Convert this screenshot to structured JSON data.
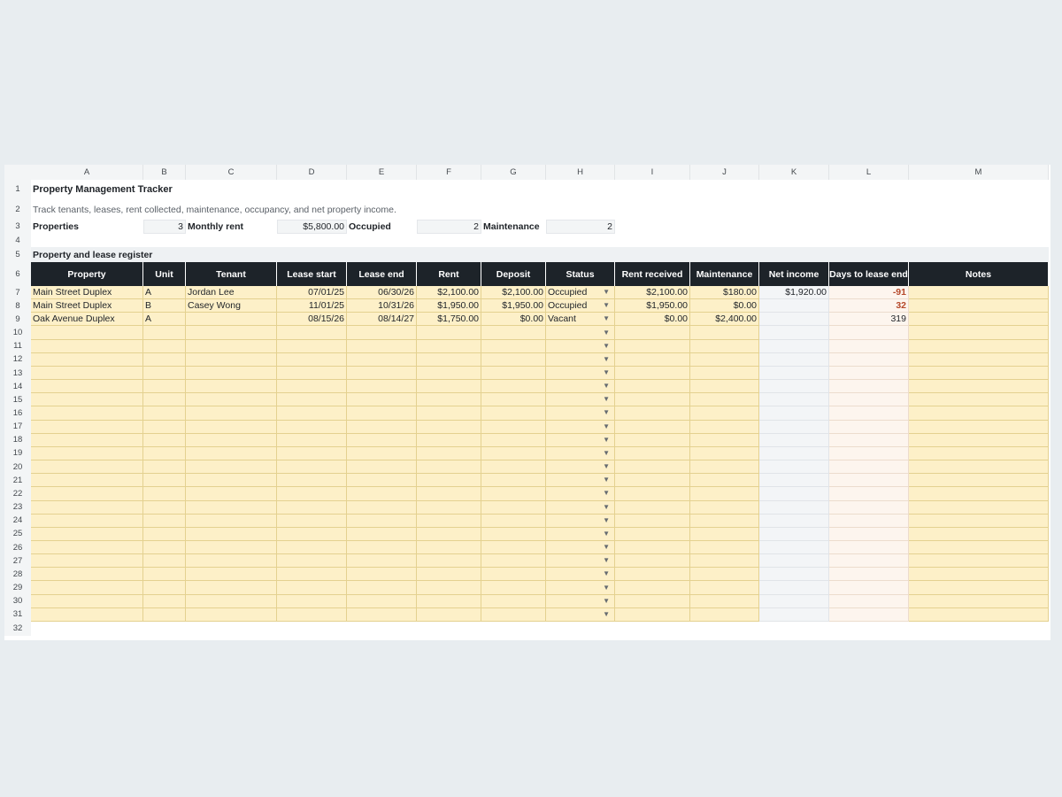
{
  "columns": [
    "A",
    "B",
    "C",
    "D",
    "E",
    "F",
    "G",
    "H",
    "I",
    "J",
    "K",
    "L",
    "M"
  ],
  "title": "Property Management Tracker",
  "subtitle": "Track tenants, leases, rent collected, maintenance, occupancy, and net property income.",
  "summary": [
    {
      "label": "Properties",
      "value": "3"
    },
    {
      "label": "Monthly rent",
      "value": "$5,800.00"
    },
    {
      "label": "Occupied",
      "value": "2"
    },
    {
      "label": "Maintenance",
      "value": "2"
    }
  ],
  "section_title": "Property and lease register",
  "table": {
    "headers": [
      "Property",
      "Unit",
      "Tenant",
      "Lease start",
      "Lease end",
      "Rent",
      "Deposit",
      "Status",
      "Rent received",
      "Maintenance",
      "Net income",
      "Days to lease end",
      "Notes"
    ],
    "rows": [
      [
        "Main Street Duplex",
        "A",
        "Jordan Lee",
        "07/01/25",
        "06/30/26",
        "$2,100.00",
        "$2,100.00",
        "Occupied",
        "$2,100.00",
        "$180.00",
        "$1,920.00",
        "-91",
        ""
      ],
      [
        "Main Street Duplex",
        "B",
        "Casey Wong",
        "11/01/25",
        "10/31/26",
        "$1,950.00",
        "$1,950.00",
        "Occupied",
        "$1,950.00",
        "$0.00",
        "",
        "32",
        ""
      ],
      [
        "Oak Avenue Duplex",
        "A",
        "",
        "08/15/26",
        "08/14/27",
        "$1,750.00",
        "$0.00",
        "Vacant",
        "$0.00",
        "$2,400.00",
        "",
        "319",
        ""
      ]
    ],
    "highlight_rows": [
      0,
      1
    ],
    "empty_rows": 22
  },
  "colors": {
    "header_bg": "#1d2329",
    "input_bg": "#fdf0c8",
    "warning_text": "#b5482a"
  },
  "dropdown_icon": "triangle-down-icon"
}
